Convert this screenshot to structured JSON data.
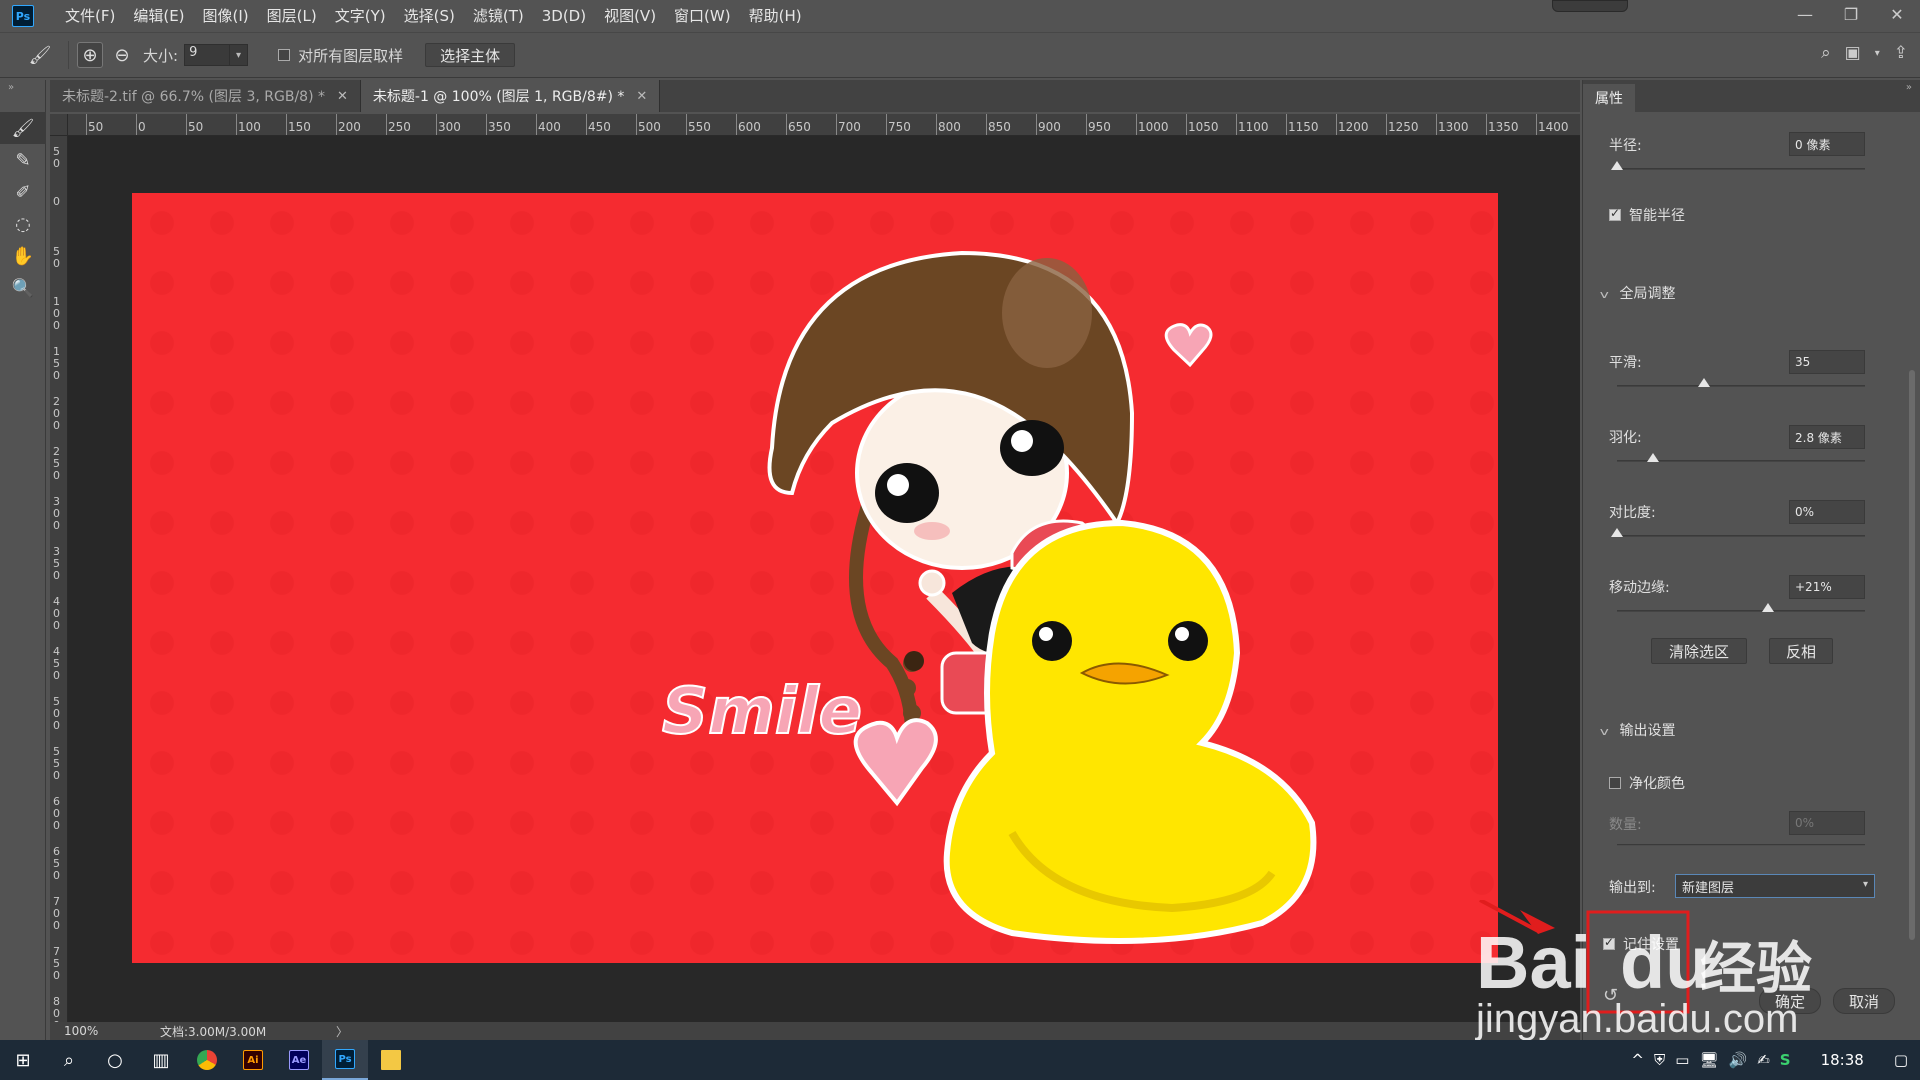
{
  "app": {
    "logo": "Ps",
    "menus": [
      "文件(F)",
      "编辑(E)",
      "图像(I)",
      "图层(L)",
      "文字(Y)",
      "选择(S)",
      "滤镜(T)",
      "3D(D)",
      "视图(V)",
      "窗口(W)",
      "帮助(H)"
    ]
  },
  "options": {
    "size_label": "大小:",
    "size_value": "9",
    "sample_all_layers": "对所有图层取样",
    "select_subject": "选择主体"
  },
  "tabs": [
    {
      "label": "未标题-2.tif @ 66.7% (图层 3, RGB/8) *",
      "active": false
    },
    {
      "label": "未标题-1 @ 100% (图层 1, RGB/8#) *",
      "active": true
    }
  ],
  "ruler": {
    "top": [
      "50",
      "0",
      "50",
      "100",
      "150",
      "200",
      "250",
      "300",
      "350",
      "400",
      "450",
      "500",
      "550",
      "600",
      "650",
      "700",
      "750",
      "800",
      "850",
      "900",
      "950",
      "1000",
      "1050",
      "1100",
      "1150",
      "1200",
      "1250",
      "1300",
      "1350",
      "1400"
    ],
    "left": [
      "50",
      "0",
      "50",
      "100",
      "150",
      "200",
      "250",
      "300",
      "350",
      "400",
      "450",
      "500",
      "550",
      "600",
      "650",
      "700",
      "750",
      "800"
    ]
  },
  "artwork": {
    "text": "Smile",
    "colors": {
      "background": "#f52b30",
      "duck": "#ffe600",
      "hair": "#6b4623",
      "heart": "#f7a5b5"
    }
  },
  "status": {
    "zoom": "100%",
    "doc": "文档:3.00M/3.00M",
    "arrow": "〉"
  },
  "panel": {
    "tab": "属性",
    "radius_label": "半径:",
    "radius_value": "0 像素",
    "radius_level": 0,
    "smart_radius": "智能半径",
    "global_section": "全局调整",
    "smooth_label": "平滑:",
    "smooth_value": "35",
    "smooth_level": 0.35,
    "feather_label": "羽化:",
    "feather_value": "2.8 像素",
    "contrast_label": "对比度:",
    "contrast_value": "0%",
    "shift_label": "移动边缘:",
    "shift_value": "+21%",
    "clear_selection": "清除选区",
    "invert": "反相",
    "output_section": "输出设置",
    "decontaminate": "净化颜色",
    "amount_label": "数量:",
    "amount_value": "0%",
    "output_to_label": "输出到:",
    "output_to_value": "新建图层",
    "remember_settings": "记住设置",
    "ok": "确定",
    "cancel": "取消"
  },
  "watermark": {
    "brand": "Bai",
    "brand_suffix": "经验",
    "url": "jingyan.baidu.com"
  },
  "taskbar": {
    "clock": "18:38"
  }
}
